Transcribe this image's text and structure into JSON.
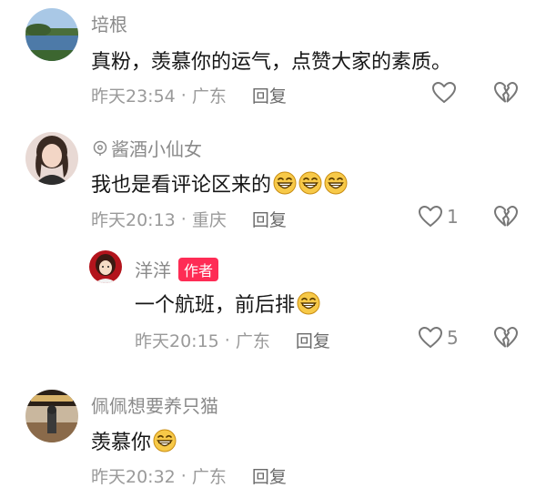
{
  "comments": [
    {
      "username": "培根",
      "text": "真粉，羡慕你的运气，点赞大家的素质。",
      "time": "昨天23:54",
      "location": "广东",
      "reply_label": "回复",
      "like_count": "",
      "avatar_icon": "lake-landscape-avatar"
    },
    {
      "username_prefix_icon": "location-pin-icon",
      "username": "酱酒小仙女",
      "text": "我也是看评论区来的",
      "emoji": [
        "grin-emoji",
        "grin-emoji",
        "grin-emoji"
      ],
      "time": "昨天20:13",
      "location": "重庆",
      "reply_label": "回复",
      "like_count": "1",
      "avatar_icon": "woman-portrait-avatar"
    },
    {
      "username": "洋洋",
      "badge": "作者",
      "text": "一个航班，前后排",
      "emoji": [
        "grin-emoji"
      ],
      "time": "昨天20:15",
      "location": "广东",
      "reply_label": "回复",
      "like_count": "5",
      "avatar_icon": "cartoon-girl-avatar"
    },
    {
      "username": "佩佩想要养只猫",
      "text": "羡慕你",
      "emoji": [
        "grin-emoji"
      ],
      "time": "昨天20:32",
      "location": "广东",
      "reply_label": "回复",
      "like_count": "",
      "avatar_icon": "shop-interior-avatar"
    }
  ],
  "dot_separator": "·",
  "colors": {
    "username": "#8a8a8a",
    "meta": "#9a9a9a",
    "badge_bg": "#fe2c55",
    "emoji_fill": "#f7c948"
  }
}
